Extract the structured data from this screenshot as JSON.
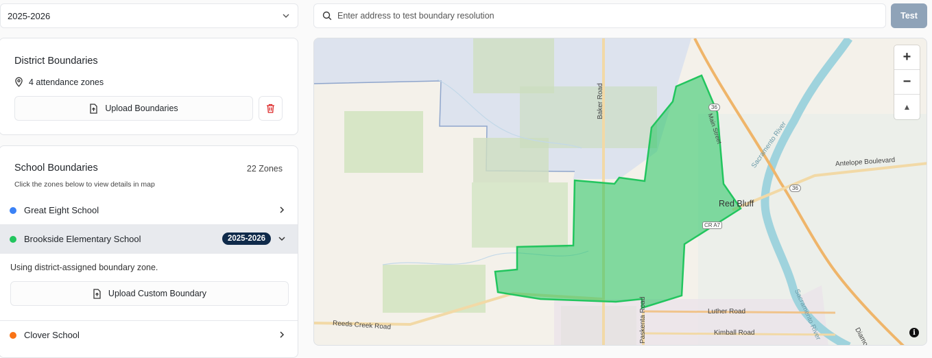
{
  "year_select": {
    "value": "2025-2026"
  },
  "district": {
    "title": "District Boundaries",
    "zones_text": "4 attendance zones",
    "upload_label": "Upload Boundaries"
  },
  "schools": {
    "title": "School Boundaries",
    "count": "22 Zones",
    "hint": "Click the zones below to view details in map",
    "items": [
      {
        "name": "Great Eight School",
        "color": "#3b82f6"
      },
      {
        "name": "Brookside Elementary School",
        "color": "#22c55e",
        "badge": "2025-2026",
        "expanded": true
      },
      {
        "name": "Clover School",
        "color": "#f97316"
      }
    ],
    "expanded_note": "Using district-assigned boundary zone.",
    "custom_upload_label": "Upload Custom Boundary"
  },
  "search": {
    "placeholder": "Enter address to test boundary resolution",
    "button": "Test"
  },
  "map": {
    "labels": {
      "city": "Red Bluff",
      "baker": "Baker Road",
      "antelope": "Antelope Boulevard",
      "reeds": "Reeds Creek Road",
      "luther": "Luther Road",
      "kimball": "Kimball Road",
      "paskenta": "Paskenta Road",
      "river": "Sacramento River",
      "river2": "Sacramento River",
      "main": "Main Street",
      "diamond": "Diamond",
      "hwy36a": "36",
      "hwy36b": "36",
      "cra7": "CR A7"
    },
    "controls": {
      "zoom_in": "+",
      "zoom_out": "−",
      "compass": "▲",
      "info": "i"
    },
    "boundary_color": "#22c55e"
  }
}
